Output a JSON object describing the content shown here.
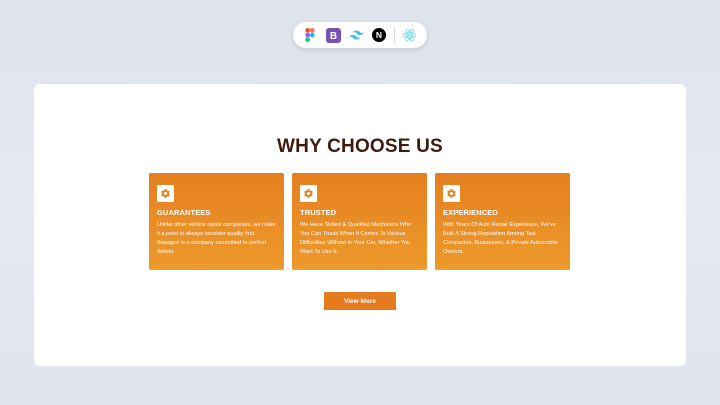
{
  "tech_bar": {
    "icons": [
      "figma-icon",
      "bootstrap-icon",
      "tailwind-icon",
      "nextjs-icon",
      "react-icon"
    ],
    "bootstrap_letter": "B",
    "nextjs_letter": "N"
  },
  "section": {
    "title": "WHY CHOOSE US"
  },
  "features": [
    {
      "icon": "gear-icon",
      "title": "GUARANTEES",
      "text": "Unlike other vehicle repair companies, we make it a point to always consider quality first. Ibiwagon is a company committed to perfect deliver."
    },
    {
      "icon": "gear-icon",
      "title": "TRUSTED",
      "text": "We Have Skilled & Qualified Mechanics Who You Can Trusts When It Comes To Various Difficulties Without In Your Car, Whether You Want To Use It."
    },
    {
      "icon": "gear-icon",
      "title": "EXPERIENCED",
      "text": "With Years Of Auto Repair Experience, We've Built A Strong Reputation Among Taxi Companies, Businesses, & Private Automobile Owners."
    }
  ],
  "cta": {
    "label": "View More"
  },
  "colors": {
    "accent": "#e57f20",
    "accent_light": "#ed9a2b",
    "title": "#3f1b0d",
    "background": "#e2e6ee",
    "card": "#ffffff"
  }
}
